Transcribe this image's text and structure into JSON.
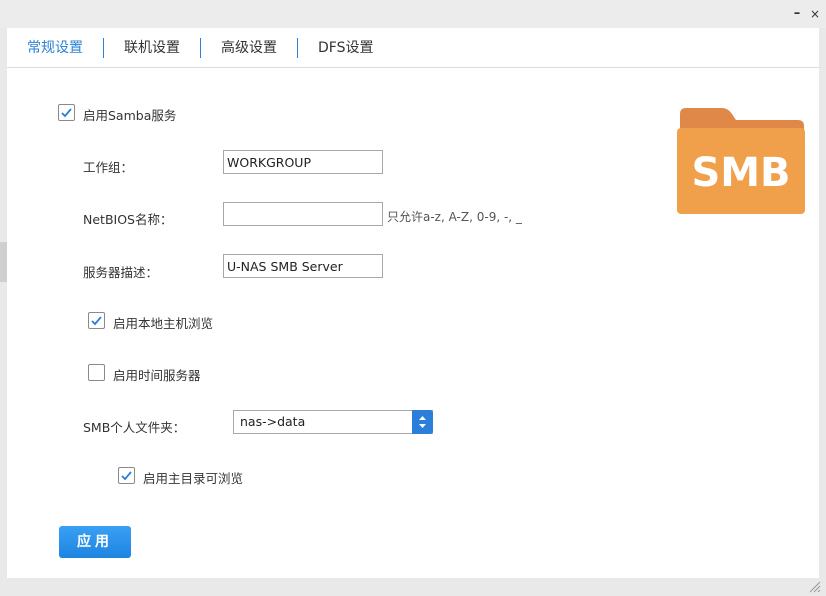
{
  "window": {
    "minimize_glyph": "–",
    "close_glyph": "×"
  },
  "tabs": [
    {
      "label": "常规设置",
      "active": true
    },
    {
      "label": "联机设置",
      "active": false
    },
    {
      "label": "高级设置",
      "active": false
    },
    {
      "label": "DFS设置",
      "active": false
    }
  ],
  "form": {
    "enable_samba": {
      "label": "启用Samba服务",
      "checked": true
    },
    "workgroup": {
      "label": "工作组：",
      "value": "WORKGROUP"
    },
    "netbios": {
      "label": "NetBIOS名称：",
      "value": "",
      "hint": "只允许a-z, A-Z, 0-9, -, _"
    },
    "description": {
      "label": "服务器描述：",
      "value": "U-NAS SMB Server"
    },
    "local_browse": {
      "label": "启用本地主机浏览",
      "checked": true
    },
    "time_server": {
      "label": "启用时间服务器",
      "checked": false
    },
    "smb_personal": {
      "label": "SMB个人文件夹：",
      "selected": "nas->data"
    },
    "home_browse": {
      "label": "启用主目录可浏览",
      "checked": true
    },
    "apply_label": "应用"
  },
  "logo": {
    "text": "SMB",
    "folder_color": "#f0a04b",
    "tab_color": "#e08848"
  },
  "colors": {
    "accent": "#2b82d4",
    "check": "#2b7fd9"
  }
}
